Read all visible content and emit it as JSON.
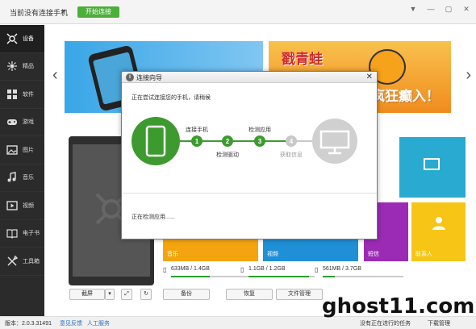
{
  "topbar": {
    "device_title": "当前没有连接手机",
    "connect_label": "开始连接",
    "window_controls": [
      "ribbon-icon",
      "minimize-icon",
      "maximize-icon",
      "close-icon"
    ]
  },
  "sidebar": {
    "items": [
      {
        "label": "设备",
        "icon": "device-icon",
        "active": true
      },
      {
        "label": "精品",
        "icon": "star-icon",
        "active": false
      },
      {
        "label": "软件",
        "icon": "apps-icon",
        "active": false
      },
      {
        "label": "游戏",
        "icon": "gamepad-icon",
        "active": false
      },
      {
        "label": "图片",
        "icon": "picture-icon",
        "active": false
      },
      {
        "label": "音乐",
        "icon": "music-icon",
        "active": false
      },
      {
        "label": "视频",
        "icon": "video-icon",
        "active": false
      },
      {
        "label": "电子书",
        "icon": "book-icon",
        "active": false
      },
      {
        "label": "工具箱",
        "icon": "tools-icon",
        "active": false
      }
    ]
  },
  "banner": {
    "game_text_line1": "戳青蛙",
    "game_text_line2": "疯狂癫入！"
  },
  "tiles": {
    "music": "音乐",
    "video": "视频",
    "sms": "短信",
    "contacts": "联系人"
  },
  "storage": [
    {
      "text": "633MB / 1.4GB",
      "fill": 0.44
    },
    {
      "text": "1.1GB / 1.2GB",
      "fill": 0.92
    },
    {
      "text": "561MB / 3.7GB",
      "fill": 0.15
    }
  ],
  "actions": {
    "screenshot": "截屏",
    "backup": "备份",
    "restore": "恢复",
    "file_manager": "文件管理"
  },
  "dialog": {
    "title": "连接向导",
    "message": "正在尝试连接您的手机，请稍候",
    "status": "正在检测应用......",
    "steps": [
      {
        "num": "1",
        "label": "连接手机",
        "done": true
      },
      {
        "num": "2",
        "label": "检测驱动",
        "done": true
      },
      {
        "num": "3",
        "label": "检测应用",
        "done": true
      },
      {
        "num": "4",
        "label": "获取信息",
        "done": false
      }
    ]
  },
  "statusbar": {
    "version": "版本：2.0.3.31491",
    "feedback": "意见反馈",
    "manual": "人工服务",
    "tasks": "没有正在进行的任务",
    "downloads": "下载管理"
  },
  "watermark": "ghost11.com",
  "colors": {
    "accent": "#4caf3a",
    "progress_done": "#3d9a2f",
    "progress_pending": "#c8c8c8",
    "sidebar_bg": "#2b2b2b"
  }
}
